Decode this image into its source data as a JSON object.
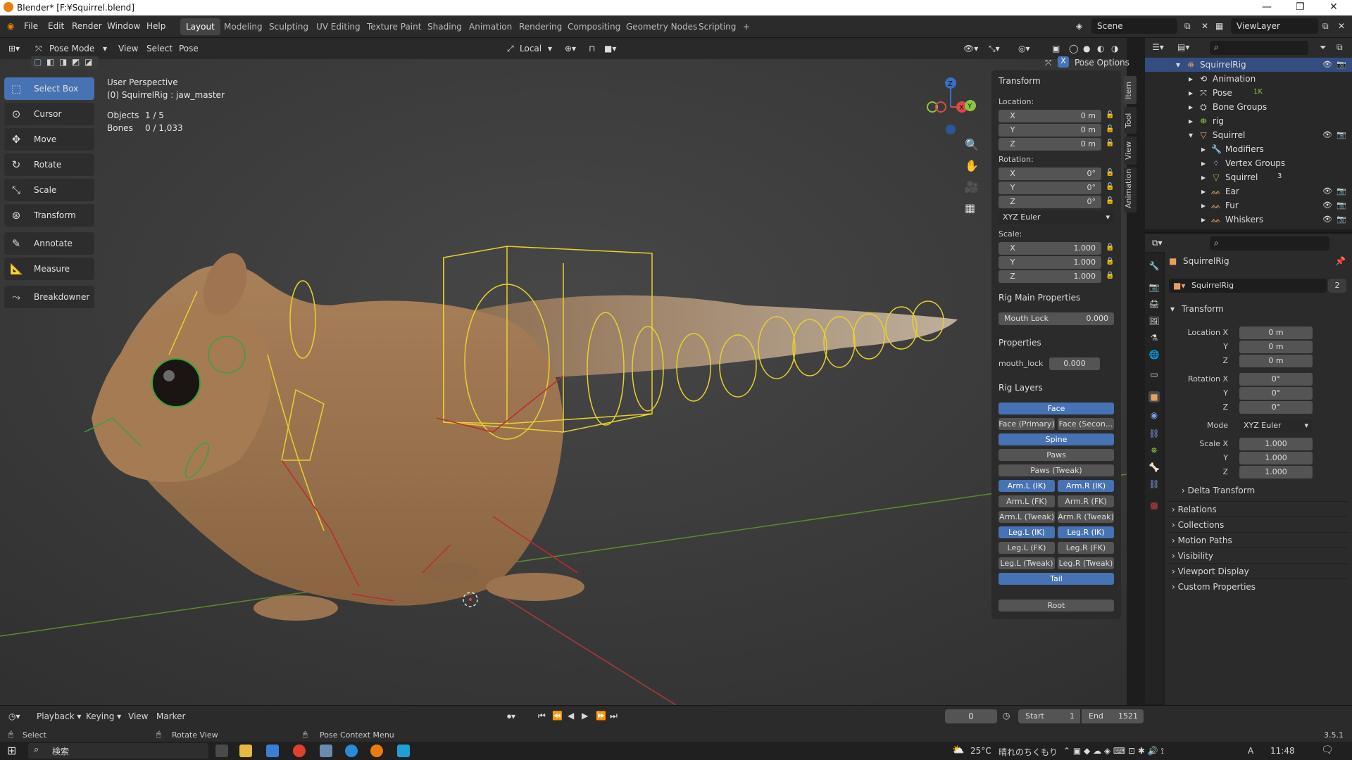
{
  "titlebar": {
    "title": "Blender* [F:¥Squirrel.blend]"
  },
  "menu": {
    "items": [
      "File",
      "Edit",
      "Render",
      "Window",
      "Help"
    ]
  },
  "workspaces": {
    "tabs": [
      "Layout",
      "Modeling",
      "Sculpting",
      "UV Editing",
      "Texture Paint",
      "Shading",
      "Animation",
      "Rendering",
      "Compositing",
      "Geometry Nodes",
      "Scripting"
    ],
    "active": "Layout"
  },
  "scene": {
    "name": "Scene",
    "view_layer": "ViewLayer"
  },
  "viewport_header": {
    "mode": "Pose Mode",
    "view": "View",
    "select": "Select",
    "pose": "Pose",
    "orientation": "Local",
    "pose_options": "Pose Options"
  },
  "tools": [
    "Select Box",
    "Cursor",
    "Move",
    "Rotate",
    "Scale",
    "Transform",
    "Annotate",
    "Measure",
    "Breakdowner"
  ],
  "overlay": {
    "perspective": "User Perspective",
    "object_info": "(0) SquirrelRig : jaw_master",
    "objects_label": "Objects",
    "objects_value": "1 / 5",
    "bones_label": "Bones",
    "bones_value": "0 / 1,033"
  },
  "npanel": {
    "tabs": [
      "Item",
      "Tool",
      "View",
      "Animation"
    ],
    "transform_title": "Transform",
    "location_label": "Location:",
    "location": [
      {
        "axis": "X",
        "value": "0 m"
      },
      {
        "axis": "Y",
        "value": "0 m"
      },
      {
        "axis": "Z",
        "value": "0 m"
      }
    ],
    "rotation_label": "Rotation:",
    "rotation": [
      {
        "axis": "X",
        "value": "0°"
      },
      {
        "axis": "Y",
        "value": "0°"
      },
      {
        "axis": "Z",
        "value": "0°"
      }
    ],
    "rotation_mode": "XYZ Euler",
    "scale_label": "Scale:",
    "scale": [
      {
        "axis": "X",
        "value": "1.000"
      },
      {
        "axis": "Y",
        "value": "1.000"
      },
      {
        "axis": "Z",
        "value": "1.000"
      }
    ],
    "rig_main_title": "Rig Main Properties",
    "mouth_lock_label": "Mouth Lock",
    "mouth_lock_value": "0.000",
    "properties_title": "Properties",
    "mouth_lock_prop_label": "mouth_lock",
    "mouth_lock_prop_value": "0.000",
    "rig_layers_title": "Rig Layers",
    "layers": {
      "face": "Face",
      "face_primary": "Face (Primary)",
      "face_secondary": "Face (Secon...",
      "spine": "Spine",
      "paws": "Paws",
      "paws_tweak": "Paws (Tweak)",
      "arm_l_ik": "Arm.L (IK)",
      "arm_r_ik": "Arm.R (IK)",
      "arm_l_fk": "Arm.L (FK)",
      "arm_r_fk": "Arm.R (FK)",
      "arm_l_tweak": "Arm.L (Tweak)",
      "arm_r_tweak": "Arm.R (Tweak)",
      "leg_l_ik": "Leg.L (IK)",
      "leg_r_ik": "Leg.R (IK)",
      "leg_l_fk": "Leg.L (FK)",
      "leg_r_fk": "Leg.R (FK)",
      "leg_l_tweak": "Leg.L (Tweak)",
      "leg_r_tweak": "Leg.R (Tweak)",
      "tail": "Tail",
      "root": "Root"
    }
  },
  "outliner": {
    "rows": [
      {
        "name": "SquirrelRig",
        "icon": "armature-icon"
      },
      {
        "name": "Animation",
        "icon": "animation-icon"
      },
      {
        "name": "Pose",
        "icon": "pose-icon",
        "badge": "1K"
      },
      {
        "name": "Bone Groups",
        "icon": "bone-groups-icon"
      },
      {
        "name": "rig",
        "icon": "rig-icon"
      },
      {
        "name": "Squirrel",
        "icon": "mesh-icon"
      },
      {
        "name": "Modifiers",
        "icon": "modifier-icon"
      },
      {
        "name": "Vertex Groups",
        "icon": "vertex-groups-icon"
      },
      {
        "name": "Squirrel",
        "icon": "mesh-data-icon",
        "badge": "3"
      },
      {
        "name": "Ear",
        "icon": "hair-icon"
      },
      {
        "name": "Fur",
        "icon": "hair-icon"
      },
      {
        "name": "Whiskers",
        "icon": "hair-icon"
      }
    ]
  },
  "properties": {
    "object_name": "SquirrelRig",
    "datablock_name": "SquirrelRig",
    "users": "2",
    "transform_title": "Transform",
    "location_x_label": "Location X",
    "y_label": "Y",
    "z_label": "Z",
    "location": [
      "0 m",
      "0 m",
      "0 m"
    ],
    "rotation_x_label": "Rotation X",
    "rotation": [
      "0°",
      "0°",
      "0°"
    ],
    "mode_label": "Mode",
    "mode_value": "XYZ Euler",
    "scale_x_label": "Scale X",
    "scale": [
      "1.000",
      "1.000",
      "1.000"
    ],
    "delta_transform": "Delta Transform",
    "sections": [
      "Relations",
      "Collections",
      "Motion Paths",
      "Visibility",
      "Viewport Display",
      "Custom Properties"
    ]
  },
  "timeline": {
    "playback": "Playback",
    "keying": "Keying",
    "view": "View",
    "marker": "Marker",
    "current_frame": "0",
    "start_label": "Start",
    "start": "1",
    "end_label": "End",
    "end": "1521"
  },
  "statusbar": {
    "select": "Select",
    "rotate_view": "Rotate View",
    "context_menu": "Pose Context Menu",
    "version": "3.5.1"
  },
  "taskbar": {
    "search": "検索",
    "weather": "25°C",
    "weather_desc": "晴れのちくもり",
    "ime": "A",
    "time": "11:48"
  },
  "colors": {
    "accent": "#4772b3",
    "rig_yellow": "#e8d030",
    "rig_red": "#c02a2a",
    "rig_green": "#3ca03c",
    "fur": "#a47a52"
  }
}
